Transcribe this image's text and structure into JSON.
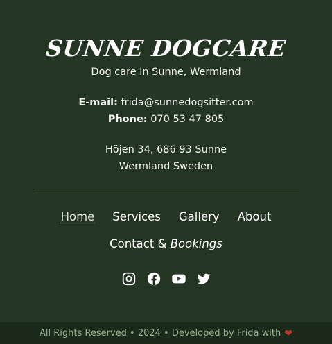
{
  "brand": {
    "name": "SUNNE DOGCARE",
    "tagline": "Dog care in Sunne, Wermland"
  },
  "contact": {
    "email_label": "E-mail:",
    "email_value": "frida@sunnedogsitter.com",
    "phone_label": "Phone:",
    "phone_value": "070 53 47 805",
    "address_line1": "Höjen 34, 686 93 Sunne",
    "address_line2": "Wermland Sweden"
  },
  "nav": {
    "items": [
      {
        "label": "Home",
        "active": true
      },
      {
        "label": "Services"
      },
      {
        "label": "Gallery"
      },
      {
        "label": "About"
      }
    ],
    "contact_text": "Contact & ",
    "bookings_text": "Bookings"
  },
  "socials": [
    {
      "icon": "instagram-icon"
    },
    {
      "icon": "facebook-icon"
    },
    {
      "icon": "youtube-icon"
    },
    {
      "icon": "twitter-icon"
    }
  ],
  "footer": {
    "text": "All Rights Reserved • 2024 • Developed by Frida with",
    "heart": "❤"
  },
  "colors": {
    "background": "#253524",
    "bottom_bar": "#1b2a1b",
    "heart": "#c0392b",
    "footer_text": "#9bb08f"
  }
}
